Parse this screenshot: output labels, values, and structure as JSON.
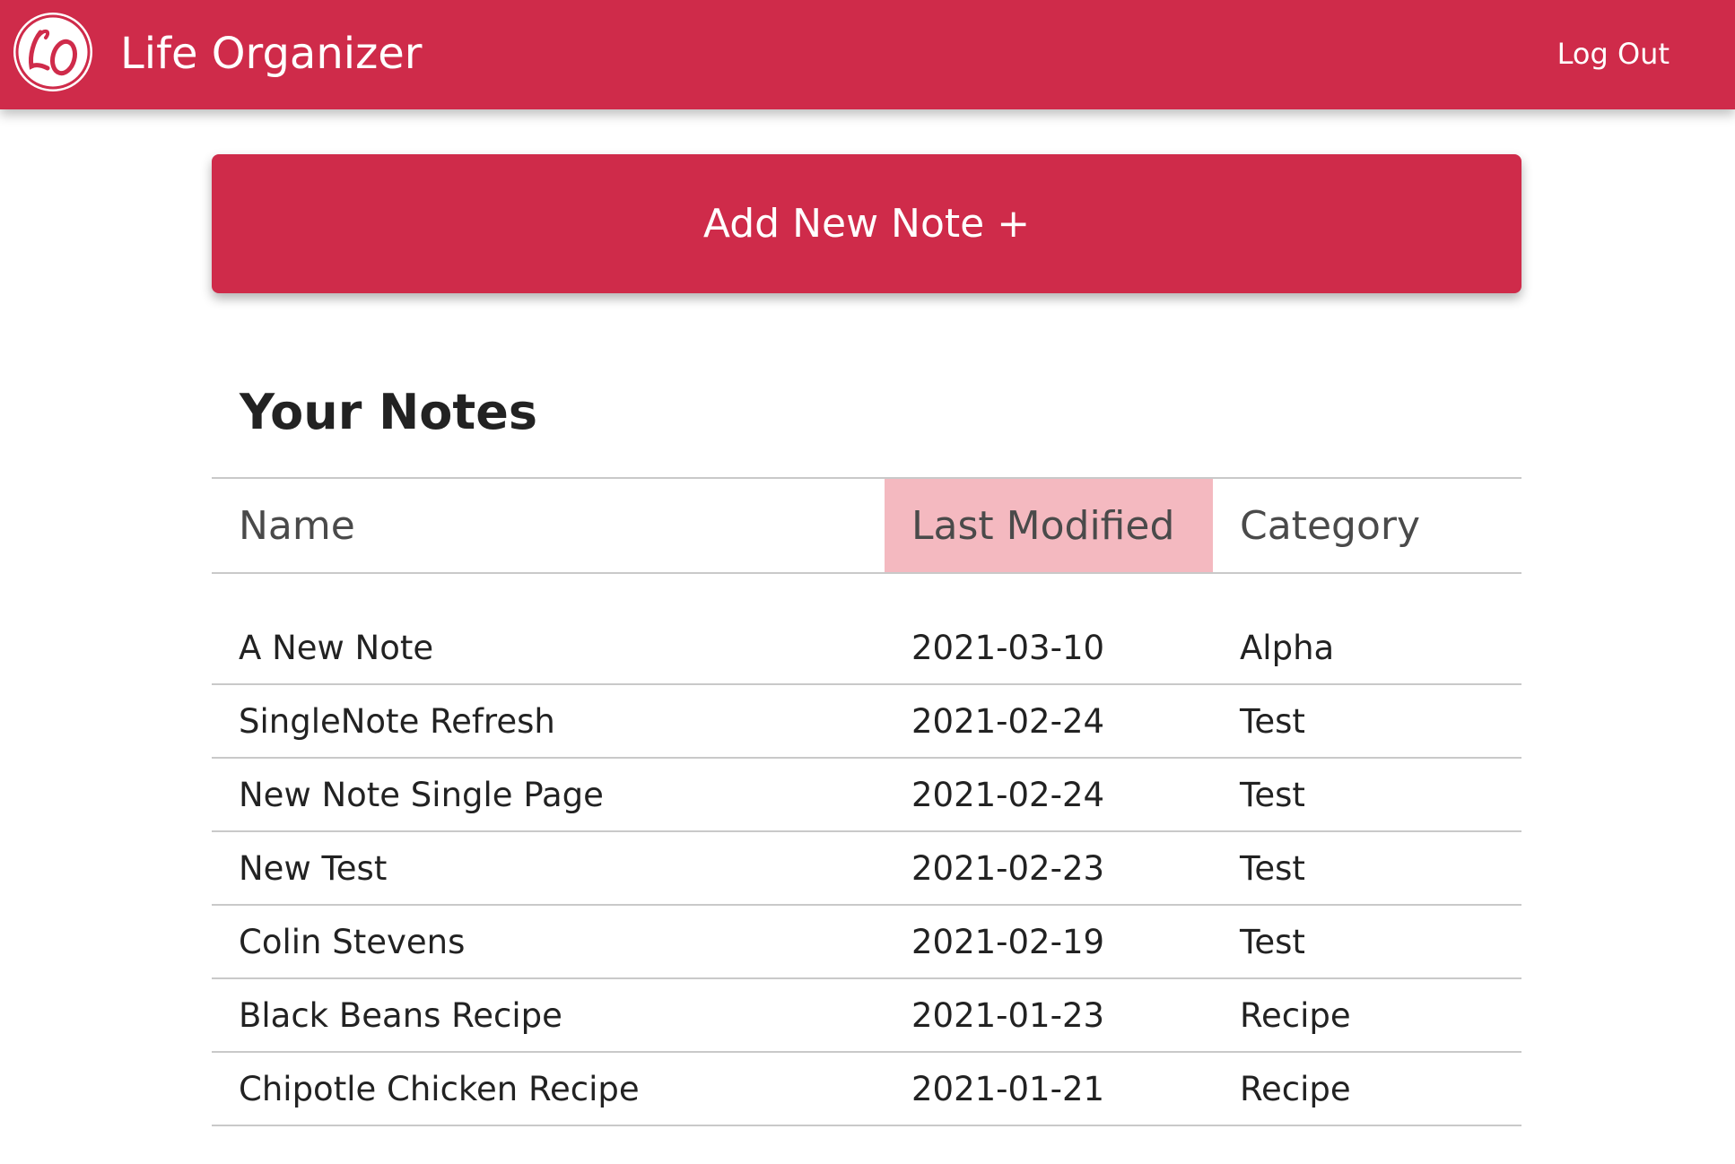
{
  "header": {
    "logo_text": "LO",
    "app_title": "Life Organizer",
    "logout_label": "Log Out"
  },
  "actions": {
    "add_note_label": "Add New Note +"
  },
  "notes_section": {
    "title": "Your Notes",
    "columns": [
      "Name",
      "Last Modified",
      "Category"
    ],
    "sorted_column": "Last Modified",
    "rows": [
      {
        "name": "A New Note",
        "last_modified": "2021-03-10",
        "category": "Alpha"
      },
      {
        "name": "SingleNote Refresh",
        "last_modified": "2021-02-24",
        "category": "Test"
      },
      {
        "name": "New Note Single Page",
        "last_modified": "2021-02-24",
        "category": "Test"
      },
      {
        "name": "New Test",
        "last_modified": "2021-02-23",
        "category": "Test"
      },
      {
        "name": "Colin Stevens",
        "last_modified": "2021-02-19",
        "category": "Test"
      },
      {
        "name": "Black Beans Recipe",
        "last_modified": "2021-01-23",
        "category": "Recipe"
      },
      {
        "name": "Chipotle Chicken Recipe",
        "last_modified": "2021-01-21",
        "category": "Recipe"
      }
    ]
  },
  "colors": {
    "brand": "#cf2b4a",
    "sorted_header": "#f4b9c0",
    "text": "#222222",
    "divider": "#c9c9c9"
  }
}
